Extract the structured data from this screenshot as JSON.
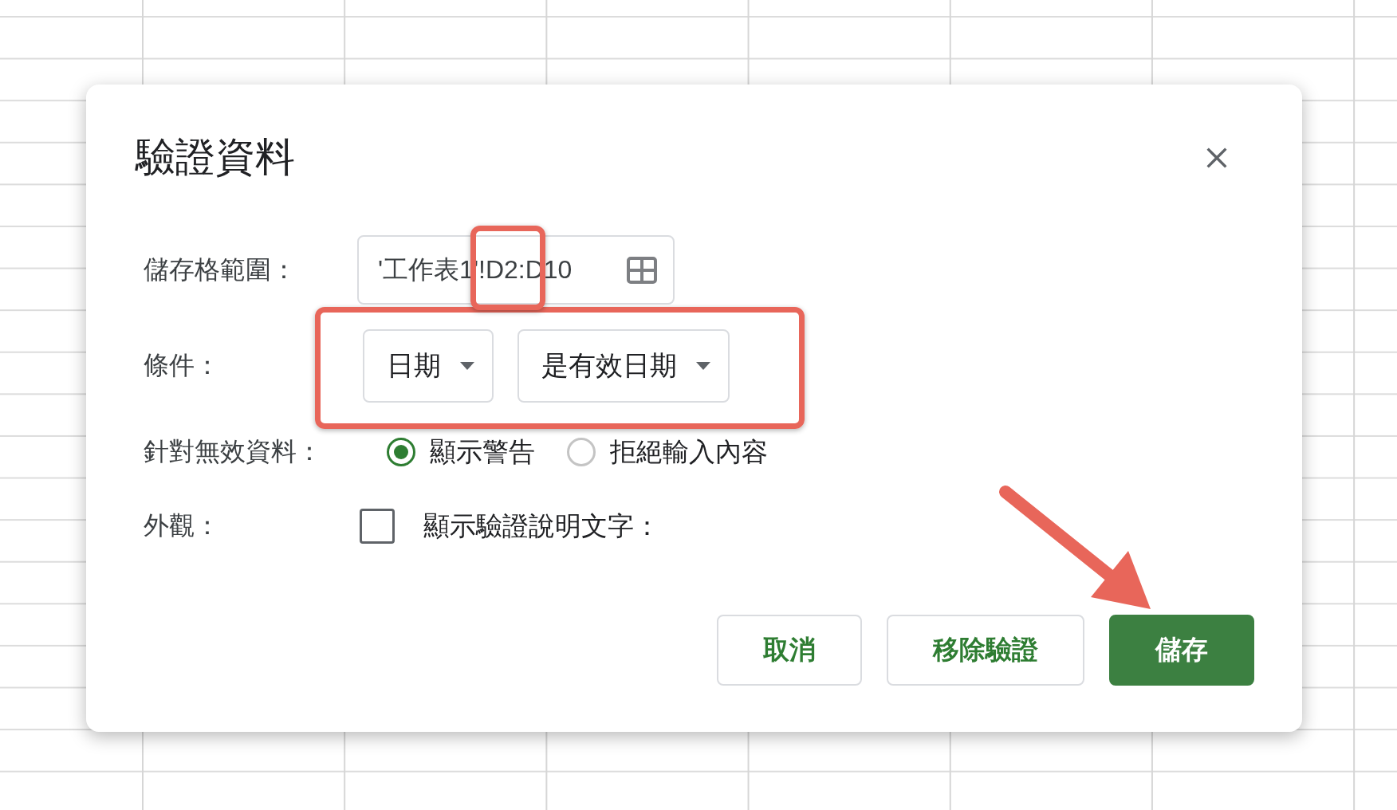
{
  "dialog": {
    "title": "驗證資料",
    "range": {
      "label": "儲存格範圍：",
      "value": "'工作表1'!D2:D10"
    },
    "criteria": {
      "label": "條件：",
      "dropdowns": [
        {
          "value": "日期"
        },
        {
          "value": "是有效日期"
        }
      ]
    },
    "invalid_data": {
      "label": "針對無效資料：",
      "options": [
        {
          "label": "顯示警告",
          "selected": true
        },
        {
          "label": "拒絕輸入內容",
          "selected": false
        }
      ]
    },
    "appearance": {
      "label": "外觀：",
      "checkbox": {
        "label": "顯示驗證說明文字：",
        "checked": false
      }
    },
    "buttons": [
      {
        "label": "取消",
        "kind": "secondary"
      },
      {
        "label": "移除驗證",
        "kind": "secondary"
      },
      {
        "label": "儲存",
        "kind": "primary"
      }
    ]
  }
}
